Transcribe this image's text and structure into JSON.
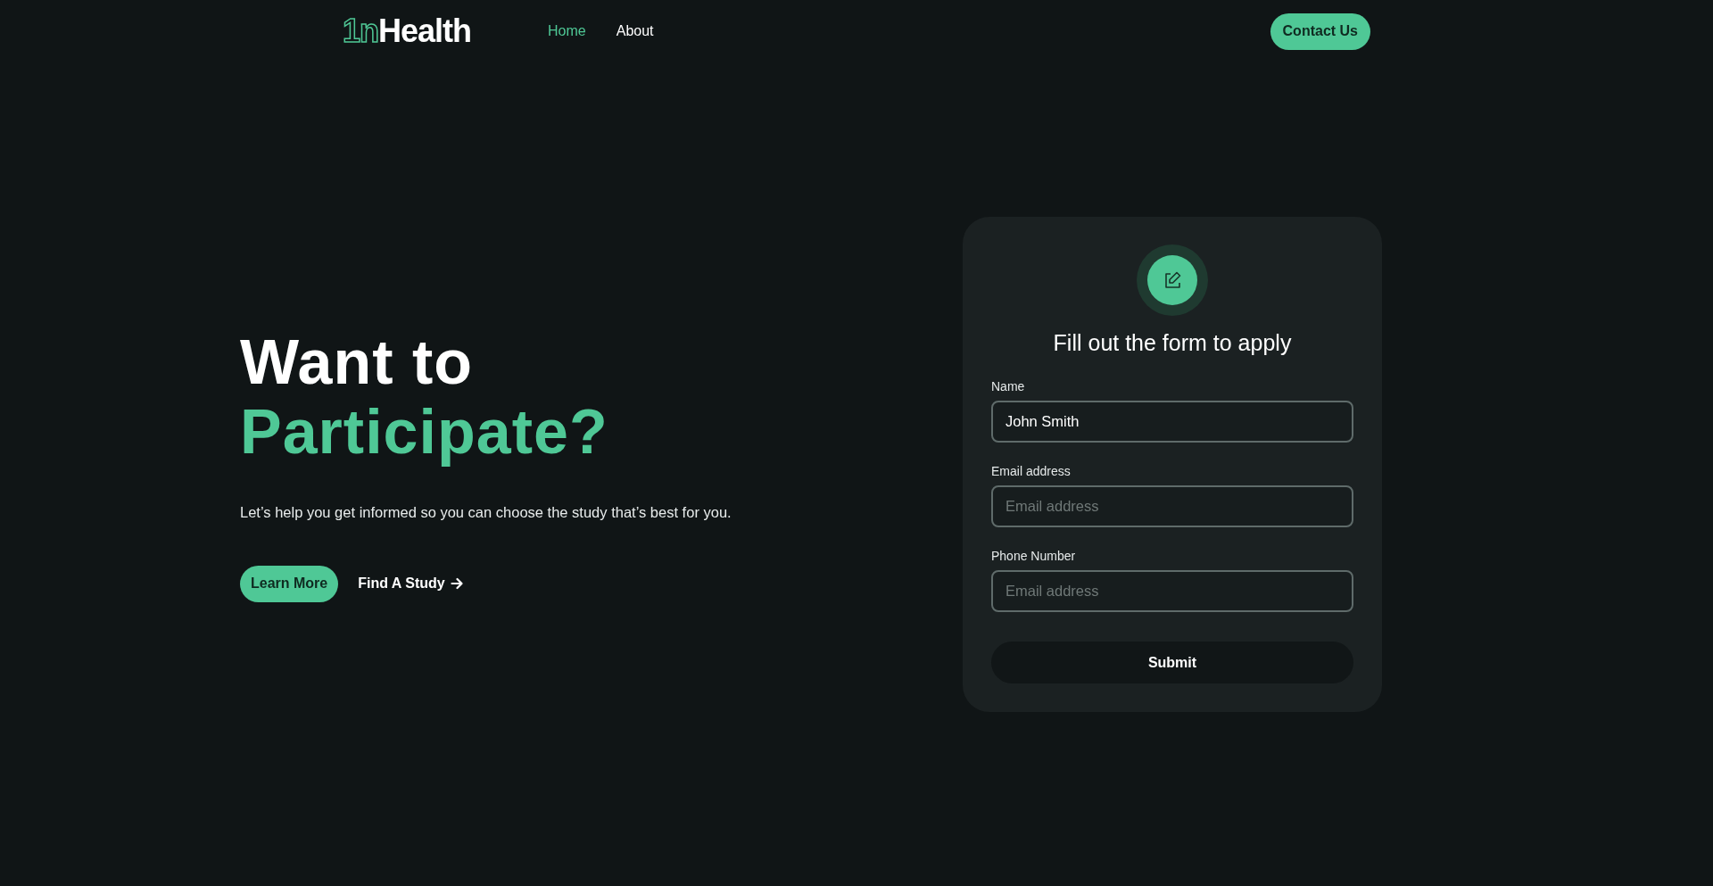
{
  "header": {
    "logo": {
      "mark": "1n",
      "name": "Health"
    },
    "nav": [
      {
        "label": "Home",
        "selected": true
      },
      {
        "label": "About",
        "selected": false
      }
    ],
    "cta": "Contact Us"
  },
  "hero": {
    "title_lines": [
      {
        "text": "Want to",
        "kind": "plain"
      },
      {
        "text": "Participate?",
        "kind": "accent"
      }
    ],
    "subtitle": "Let’s help you get informed so you can choose the study  that’s best for you.",
    "primary_button": "Learn More",
    "link": "Find A Study"
  },
  "form": {
    "title": "Fill out the form to apply",
    "fields": [
      {
        "label": "Name",
        "value": "John Smith"
      },
      {
        "label": "Email address",
        "placeholder": "Email address"
      },
      {
        "label": "Phone Number",
        "placeholder": "Email address"
      }
    ],
    "submit": "Submit"
  }
}
